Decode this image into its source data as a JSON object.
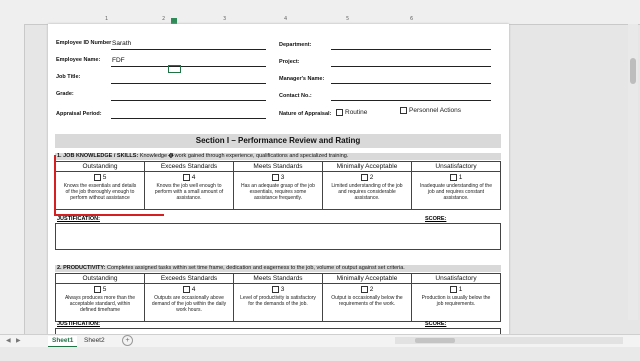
{
  "ruler": {
    "h1": "1",
    "h2": "2",
    "h3": "3",
    "h4": "4",
    "h5": "5",
    "h6": "6"
  },
  "header": {
    "employee_id_label": "Employee ID Number",
    "employee_id_value": "Sarath",
    "employee_name_label": "Employee Name:",
    "employee_name_value": "FDF",
    "job_title_label": "Job Title:",
    "grade_label": "Grade:",
    "appraisal_period_label": "Appraisal Period:",
    "department_label": "Department:",
    "project_label": "Project:",
    "manager_label": "Manager's Name:",
    "contact_label": "Contact No.:",
    "nature_label": "Nature of Appraisal:",
    "routine": "Routine",
    "personnel_actions": "Personnel Actions"
  },
  "section_title": "Section I – Performance Review and Rating",
  "ratings": [
    "Outstanding",
    "Exceeds Standards",
    "Meets Standards",
    "Minimally Acceptable",
    "Unsatisfactory"
  ],
  "scores": [
    "5",
    "4",
    "3",
    "2",
    "1"
  ],
  "criteria": [
    {
      "title": "1. JOB KNOWLEDGE / SKILLS:",
      "desc": " Knowledge of work gained through experience, qualifications and specialized training.",
      "descs": [
        "Knows the essentials and details of the job thoroughly enough to perform without assistance",
        "Knows the job well enough to perform with a small amount of assistance.",
        "Has an adequate grasp of the job essentials, requires some assistance frequently.",
        "Limited understanding of the job and requires considerable assistance.",
        "Inadequate understanding of the job and requires constant assistance."
      ]
    },
    {
      "title": "2. PRODUCTIVITY:",
      "desc": " Completes assigned tasks within set time frame, dedication and eagerness to the job, volume of output against set criteria.",
      "descs": [
        "Always produces more than the acceptable standard, within defined timeframe",
        "Outputs are occasionally above demand of the job within the daily work hours.",
        "Level of productivity is satisfactory for the demands of the job.",
        "Output is occasionally below the requirements of the work.",
        "Production is usually below the job requirements."
      ]
    }
  ],
  "justification_label": "JUSTIFICATION:",
  "score_label": "SCORE:",
  "sheets": [
    "Sheet1",
    "Sheet2"
  ]
}
